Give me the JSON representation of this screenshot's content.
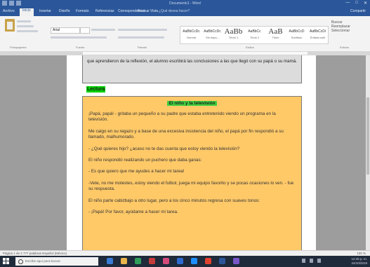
{
  "window": {
    "title": "Documento1 - Word",
    "controls": [
      "—",
      "□",
      "✕"
    ]
  },
  "ribbon_tabs": {
    "items": [
      "Archivo",
      "Inicio",
      "Insertar",
      "Diseño",
      "Formato",
      "Referencias",
      "Correspondencia",
      "Revisar",
      "Vista"
    ],
    "search": "¿Qué desea hacer?",
    "share": "Compartir"
  },
  "ribbon": {
    "font_name": "Arial",
    "styles": [
      {
        "sample": "AaBbCcDc",
        "name": "Normal"
      },
      {
        "sample": "AaBbCcDc",
        "name": "Sin espa..."
      },
      {
        "sample": "AaBb",
        "name": "Título 1"
      },
      {
        "sample": "AaBbCc",
        "name": "Título 2"
      },
      {
        "sample": "AaB",
        "name": "Título"
      },
      {
        "sample": "AaBbCcD",
        "name": "Subtítulo"
      },
      {
        "sample": "AaBbCcDi",
        "name": "Énfasis sutil"
      }
    ],
    "edit": [
      "Buscar",
      "Reemplazar",
      "Seleccionar"
    ],
    "group_labels": [
      "Portapapeles",
      "Fuente",
      "Párrafo",
      "Estilos",
      "Edición"
    ]
  },
  "document": {
    "intro_text": "que aprendieron de la reflexión, el alumno escribirá las conclusiones a las que llegó con su papá o su mamá.",
    "lectura_label": "Lectura",
    "story_title": "El niño y la televisión",
    "paragraphs": [
      "¡Papá, papá! - gritaba un pequeño a su padre que estaba entretenido viendo un programa en la televisión.",
      "Me caigo en su regazo y a base de una excesiva insistencia del niño, el papá por fin respondió a su llamado, malhumorado.",
      "- ¿Qué quieres hijo? ¿acaso no te das cuenta que estoy viendo la televisión?",
      "El niño respondió realizando un puchero que daba ganas:",
      "- Es que quiero que me ayudes a hacer mi tarea!",
      "-Vete, no me molestes, estoy viendo el futbol, juega mi equipo favorito y se pocas ocasiones lo ven. - fue su respuesta.",
      "El niño parte cabizbajo a otro lugar, pero a los cinco minutos regresa con suaves tonos:",
      "- ¡Papá! Por favor, ayúdame a hacer mi tarea."
    ]
  },
  "statusbar": {
    "left": "Página 1 de 2    777 palabras    Español (México)",
    "right": "100 %"
  },
  "taskbar": {
    "search_placeholder": "Escribe aquí para buscar",
    "time": "12:45 p. m.",
    "date": "24/10/2019",
    "app_colors": [
      "#3a7bd5",
      "#e8b64a",
      "#2f9e5b",
      "#c43c3c",
      "#d44a7a",
      "#2e6bd1",
      "#1f8fff",
      "#e1412d",
      "#2b579a",
      "#7a56c9"
    ]
  },
  "colors": {
    "word_blue": "#2b579a",
    "story_bg": "#ffc968",
    "highlight_green": "#00d000"
  }
}
